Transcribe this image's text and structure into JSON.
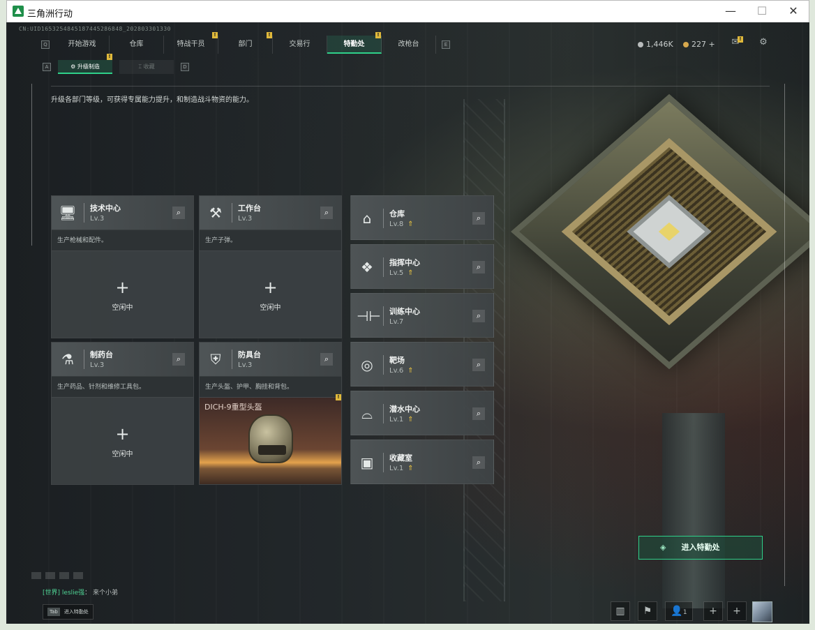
{
  "window": {
    "title": "三角洲行动",
    "minimize": "—",
    "maximize": "☐",
    "close": "✕"
  },
  "player_id": "CN:UID1653254845187445286848_202803301330",
  "nav": {
    "left_key": "Q",
    "right_key": "E",
    "tabs": [
      {
        "label": "开始游戏",
        "alert": false
      },
      {
        "label": "仓库",
        "alert": false
      },
      {
        "label": "特战干员",
        "alert": true
      },
      {
        "label": "部门",
        "alert": true
      },
      {
        "label": "交易行",
        "alert": false
      },
      {
        "label": "特勤处",
        "alert": true,
        "active": true
      },
      {
        "label": "改枪台",
        "alert": false
      }
    ],
    "alert_mark": "!"
  },
  "currency": {
    "coins": "1,446K",
    "gold": "227 +"
  },
  "header_icons": [
    "mail-icon",
    "settings-icon"
  ],
  "subtabs": {
    "left_key": "A",
    "right_key": "D",
    "items": [
      {
        "label": "升级制造",
        "active": true,
        "alert": true
      },
      {
        "label": "收藏",
        "active": false
      }
    ]
  },
  "description": "升级各部门等级，可获得专属能力提升，和制造战斗物资的能力。",
  "workbenches": [
    {
      "name": "技术中心",
      "level": "Lv.3",
      "sub": "生产枪械和配件。",
      "state": "idle",
      "icon": "computer-icon"
    },
    {
      "name": "工作台",
      "level": "Lv.3",
      "sub": "生产子弹。",
      "state": "idle",
      "icon": "tools-icon"
    },
    {
      "name": "制药台",
      "level": "Lv.3",
      "sub": "生产药品、针剂和维修工具包。",
      "state": "idle",
      "icon": "microscope-icon"
    },
    {
      "name": "防具台",
      "level": "Lv.3",
      "sub": "生产头盔、护甲、胸挂和背包。",
      "state": "crafting",
      "icon": "armor-icon",
      "crafting_item": "DICH-9重型头盔"
    }
  ],
  "idle_label": "空闲中",
  "plus_sign": "+",
  "facilities": [
    {
      "name": "仓库",
      "level": "Lv.8",
      "upgradable": true,
      "icon": "warehouse-icon"
    },
    {
      "name": "指挥中心",
      "level": "Lv.5",
      "upgradable": true,
      "icon": "command-icon"
    },
    {
      "name": "训练中心",
      "level": "Lv.7",
      "upgradable": false,
      "icon": "dumbbell-icon"
    },
    {
      "name": "靶场",
      "level": "Lv.6",
      "upgradable": true,
      "icon": "target-icon"
    },
    {
      "name": "潜水中心",
      "level": "Lv.1",
      "upgradable": true,
      "icon": "diving-icon"
    },
    {
      "name": "收藏室",
      "level": "Lv.1",
      "upgradable": true,
      "icon": "collection-icon"
    }
  ],
  "enter_button": "进入特勤处",
  "chat": {
    "channel": "[世界]",
    "user": "leslie强",
    "message": "来个小弟"
  },
  "tab_hint": {
    "key": "Tab",
    "text": "进入特勤处"
  },
  "friends_count": "1",
  "colors": {
    "accent_green": "#2fd18a",
    "alert_yellow": "#e0b93b",
    "upgrade_arrow": "#e6c040"
  }
}
